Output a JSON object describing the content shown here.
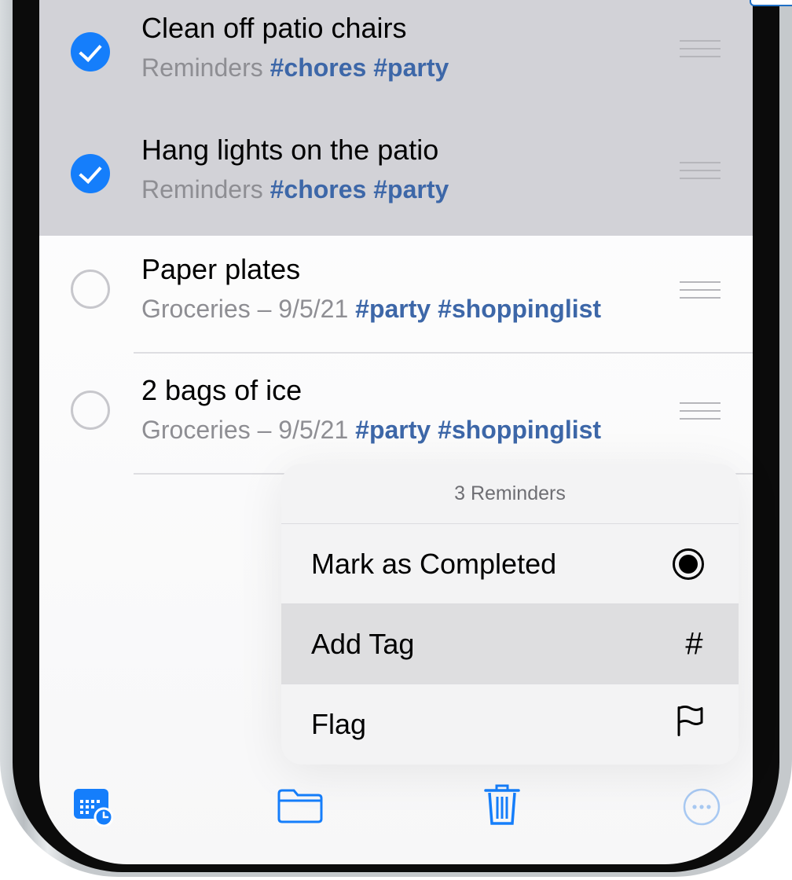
{
  "reminders": [
    {
      "title": "Clean off patio chairs",
      "list": "Reminders",
      "tags": "#chores #party",
      "completed": true
    },
    {
      "title": "Hang lights on the patio",
      "list": "Reminders",
      "tags": "#chores #party",
      "completed": true
    },
    {
      "title": "Paper plates",
      "list": "Groceries – 9/5/21",
      "tags": "#party #shoppinglist",
      "completed": false
    },
    {
      "title": "2 bags of ice",
      "list": "Groceries – 9/5/21",
      "tags": "#party #shoppinglist",
      "completed": false
    }
  ],
  "menu": {
    "header": "3 Reminders",
    "items": [
      {
        "label": "Mark as Completed",
        "icon": "filled-circle-icon"
      },
      {
        "label": "Add Tag",
        "icon": "hashtag-icon",
        "glyph": "#"
      },
      {
        "label": "Flag",
        "icon": "flag-icon"
      }
    ]
  },
  "toolbar": {
    "icons": [
      "calendar-clock-icon",
      "folder-icon",
      "trash-icon",
      "more-icon"
    ]
  },
  "colors": {
    "accent": "#157efb",
    "tag": "#3d67a8",
    "selected_row": "#d2d2d7"
  }
}
